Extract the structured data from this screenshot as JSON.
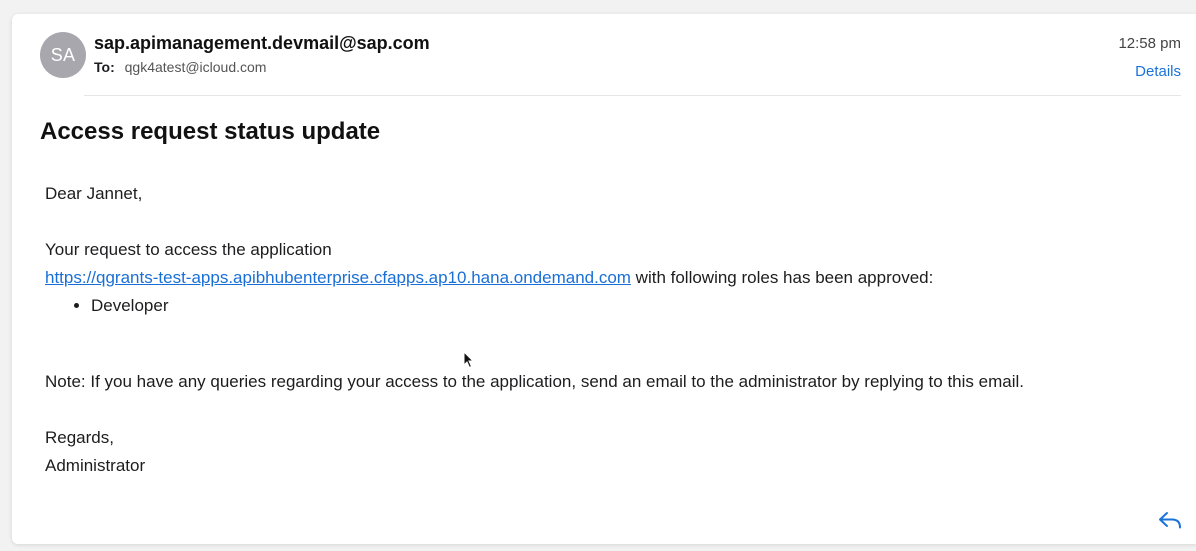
{
  "email": {
    "avatar_initials": "SA",
    "sender": "sap.apimanagement.devmail@sap.com",
    "to_label": "To:",
    "to_address": "qgk4atest@icloud.com",
    "time": "12:58 pm",
    "details_label": "Details",
    "subject": "Access request status update",
    "greeting": "Dear Jannet,",
    "request_intro": "Your request to access the application",
    "app_link": "https://qgrants-test-apps.apibhubenterprise.cfapps.ap10.hana.ondemand.com",
    "request_suffix": " with following roles has been approved:",
    "roles": [
      "Developer"
    ],
    "note": "Note: If you have any queries regarding your access to the application, send an email to the administrator by replying to this email.",
    "closing": "Regards,",
    "signature": "Administrator"
  },
  "icons": {
    "reply": "reply-icon",
    "cursor": "mouse-pointer-icon"
  },
  "colors": {
    "accent": "#1a73d9",
    "link": "#1a6fd6",
    "avatar_bg": "#a7a7ad"
  }
}
